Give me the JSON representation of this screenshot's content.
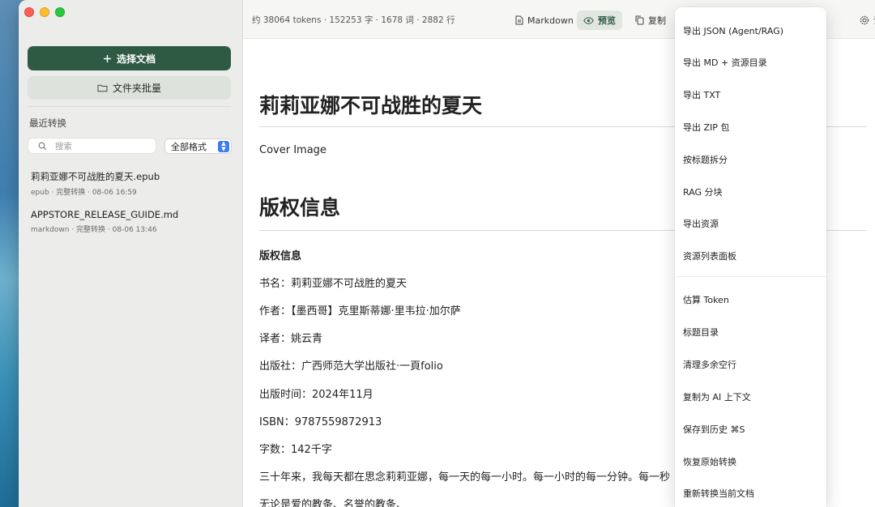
{
  "sidebar": {
    "select_doc_label": "选择文档",
    "folder_batch_label": "文件夹批量",
    "section_title": "最近转换",
    "search_placeholder": "搜索",
    "format_select": "全部格式",
    "recent": [
      {
        "name": "莉莉亚娜不可战胜的夏天.epub",
        "meta": "epub · 完整转换 · 08-06 16:59"
      },
      {
        "name": "APPSTORE_RELEASE_GUIDE.md",
        "meta": "markdown · 完整转换 · 08-06 13:46"
      }
    ]
  },
  "toolbar": {
    "stats": "约 38064 tokens · 152253 字 · 1678 词 · 2882 行",
    "markdown_label": "Markdown",
    "preview_label": "预览",
    "copy_label": "复制",
    "settings_label": "设置"
  },
  "content": {
    "h1_title": "莉莉亚娜不可战胜的夏天",
    "cover": "Cover Image",
    "h1_copyright": "版权信息",
    "copyright_bold": "版权信息",
    "lines": [
      "书名：莉莉亚娜不可战胜的夏天",
      "作者：【墨西哥】克里斯蒂娜·里韦拉·加尔萨",
      "译者：姚云青",
      "出版社：广西师范大学出版社·一頁folio",
      "出版时间：2024年11月",
      "ISBN：9787559872913",
      "字数：142千字",
      "三十年来，我每天都在思念莉莉亚娜，每一天的每一小时。每一小时的每一分钟。每一秒",
      "无论是爱的教条、名誉的教条、"
    ]
  },
  "menu": {
    "items_a": [
      "导出 JSON (Agent/RAG)",
      "导出 MD + 资源目录",
      "导出 TXT",
      "导出 ZIP 包",
      "按标题拆分",
      "RAG 分块",
      "导出资源",
      "资源列表面板"
    ],
    "items_b": [
      "估算 Token",
      "标题目录",
      "清理多余空行",
      "复制为 AI 上下文",
      "保存到历史 ⌘S",
      "恢复原始转换",
      "重新转换当前文档"
    ]
  }
}
